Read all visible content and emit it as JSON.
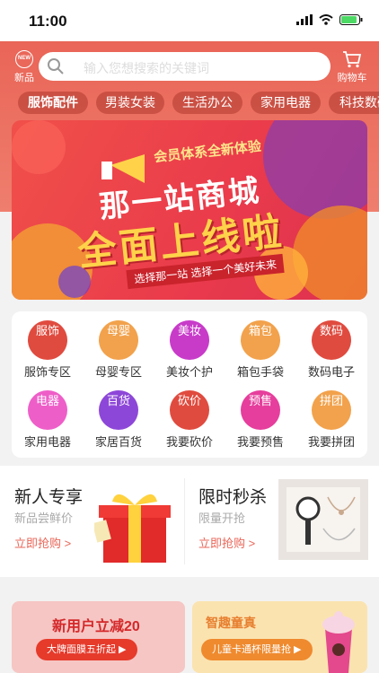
{
  "status": {
    "time": "11:00"
  },
  "header": {
    "new_label": "新品",
    "new_badge": "NEW",
    "search_placeholder": "输入您想搜索的关键词",
    "cart_label": "购物车"
  },
  "categories": [
    "服饰配件",
    "男装女装",
    "生活办公",
    "家用电器",
    "科技数码"
  ],
  "banner": {
    "line1": "会员体系全新体验",
    "line2": "那一站商城",
    "line3": "全面上线啦",
    "line4": "选择那一站 选择一个美好未来"
  },
  "grid": [
    {
      "icon": "服饰",
      "label": "服饰专区",
      "color": "#e04b3f",
      "icon_name": "clothing-icon"
    },
    {
      "icon": "母婴",
      "label": "母婴专区",
      "color": "#f2a24c",
      "icon_name": "baby-icon"
    },
    {
      "icon": "美妆",
      "label": "美妆个护",
      "color": "#c83bc9",
      "icon_name": "makeup-icon"
    },
    {
      "icon": "箱包",
      "label": "箱包手袋",
      "color": "#f2a24c",
      "icon_name": "bag-icon"
    },
    {
      "icon": "数码",
      "label": "数码电子",
      "color": "#e04b3f",
      "icon_name": "digital-icon"
    },
    {
      "icon": "电器",
      "label": "家用电器",
      "color": "#ee5ec8",
      "icon_name": "appliance-icon"
    },
    {
      "icon": "百货",
      "label": "家居百货",
      "color": "#8d47d8",
      "icon_name": "home-goods-icon"
    },
    {
      "icon": "砍价",
      "label": "我要砍价",
      "color": "#e04b3f",
      "icon_name": "bargain-icon"
    },
    {
      "icon": "预售",
      "label": "我要预售",
      "color": "#e63e9c",
      "icon_name": "presale-icon"
    },
    {
      "icon": "拼团",
      "label": "我要拼团",
      "color": "#f2a24c",
      "icon_name": "group-buy-icon"
    }
  ],
  "promo": {
    "left": {
      "title": "新人专享",
      "sub": "新品尝鲜价",
      "link": "立即抢购 >"
    },
    "right": {
      "title": "限时秒杀",
      "sub": "限量开抢",
      "link": "立即抢购 >"
    }
  },
  "bottom": {
    "left": {
      "title": "新用户立减20",
      "button": "大牌面膜五折起 ▶"
    },
    "right": {
      "title": "智趣童真",
      "button": "儿童卡通杯限量抢 ▶"
    }
  }
}
